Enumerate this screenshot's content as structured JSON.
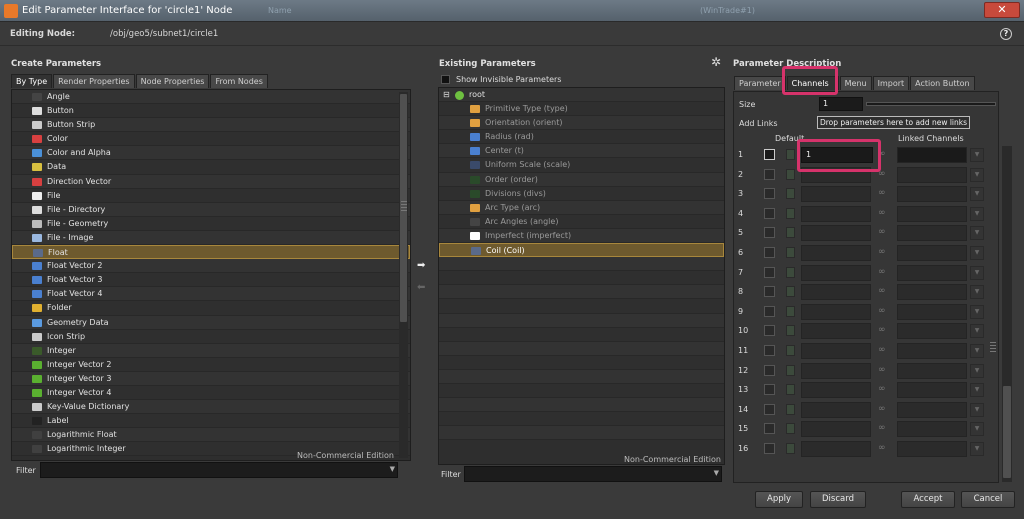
{
  "window": {
    "title": "Edit Parameter Interface for 'circle1' Node",
    "ghost_left": "Name",
    "ghost_right": "(WinTrade#1)",
    "close_label": "✕"
  },
  "editing": {
    "label": "Editing Node:",
    "path": "/obj/geo5/subnet1/circle1",
    "help_label": "?"
  },
  "create": {
    "title": "Create Parameters",
    "tabs": [
      "By Type",
      "Render Properties",
      "Node Properties",
      "From Nodes"
    ],
    "items": [
      {
        "label": "Angle",
        "icon": "angle-icon",
        "color": "#444444"
      },
      {
        "label": "Button",
        "icon": "button-icon",
        "color": "#dddddd"
      },
      {
        "label": "Button Strip",
        "icon": "button-strip-icon",
        "color": "#cccccc"
      },
      {
        "label": "Color",
        "icon": "color-icon",
        "color": "#d84040"
      },
      {
        "label": "Color and Alpha",
        "icon": "color-alpha-icon",
        "color": "#4a90d8"
      },
      {
        "label": "Data",
        "icon": "data-icon",
        "color": "#d8c040"
      },
      {
        "label": "Direction Vector",
        "icon": "direction-vector-icon",
        "color": "#d84040"
      },
      {
        "label": "File",
        "icon": "file-icon",
        "color": "#eeeeee"
      },
      {
        "label": "File - Directory",
        "icon": "file-directory-icon",
        "color": "#dddddd"
      },
      {
        "label": "File - Geometry",
        "icon": "file-geometry-icon",
        "color": "#bbbbbb"
      },
      {
        "label": "File - Image",
        "icon": "file-image-icon",
        "color": "#9ab8e0"
      },
      {
        "label": "Float",
        "icon": "float-icon",
        "color": "#5a6a8a"
      },
      {
        "label": "Float Vector 2",
        "icon": "float-vector2-icon",
        "color": "#4a80d0"
      },
      {
        "label": "Float Vector 3",
        "icon": "float-vector3-icon",
        "color": "#4a80d0"
      },
      {
        "label": "Float Vector 4",
        "icon": "float-vector4-icon",
        "color": "#4a80d0"
      },
      {
        "label": "Folder",
        "icon": "folder-icon",
        "color": "#e0b030"
      },
      {
        "label": "Geometry Data",
        "icon": "geometry-data-icon",
        "color": "#5a9ae0"
      },
      {
        "label": "Icon Strip",
        "icon": "icon-strip-icon",
        "color": "#cccccc"
      },
      {
        "label": "Integer",
        "icon": "integer-icon",
        "color": "#3a5a2a"
      },
      {
        "label": "Integer Vector 2",
        "icon": "integer-vector2-icon",
        "color": "#5ab030"
      },
      {
        "label": "Integer Vector 3",
        "icon": "integer-vector3-icon",
        "color": "#5ab030"
      },
      {
        "label": "Integer Vector 4",
        "icon": "integer-vector4-icon",
        "color": "#5ab030"
      },
      {
        "label": "Key-Value Dictionary",
        "icon": "key-value-icon",
        "color": "#cccccc"
      },
      {
        "label": "Label",
        "icon": "label-icon",
        "color": "#222222"
      },
      {
        "label": "Logarithmic Float",
        "icon": "log-float-icon",
        "color": "#404040"
      },
      {
        "label": "Logarithmic Integer",
        "icon": "log-integer-icon",
        "color": "#404040"
      }
    ],
    "selected_index": 11,
    "watermark": "Non-Commercial Edition",
    "filter_label": "Filter"
  },
  "existing": {
    "title": "Existing Parameters",
    "show_invisible": "Show Invisible Parameters",
    "root": "root",
    "items": [
      {
        "label": "Primitive Type (type)",
        "icon": "menu-icon",
        "color": "#e0a040"
      },
      {
        "label": "Orientation (orient)",
        "icon": "menu-icon",
        "color": "#e0a040"
      },
      {
        "label": "Radius (rad)",
        "icon": "float-vector2-icon",
        "color": "#4a80d0"
      },
      {
        "label": "Center (t)",
        "icon": "float-vector2-icon",
        "color": "#4a80d0"
      },
      {
        "label": "Uniform Scale (scale)",
        "icon": "float-icon",
        "color": "#3a4a6a"
      },
      {
        "label": "Order (order)",
        "icon": "integer-icon",
        "color": "#2a4a2a"
      },
      {
        "label": "Divisions (divs)",
        "icon": "integer-icon",
        "color": "#2a4a2a"
      },
      {
        "label": "Arc Type (arc)",
        "icon": "menu-icon",
        "color": "#e0a040"
      },
      {
        "label": "Arc Angles (angle)",
        "icon": "angle-icon",
        "color": "#444444"
      },
      {
        "label": "Imperfect (imperfect)",
        "icon": "checkbox-icon",
        "color": "#ffffff"
      },
      {
        "label": "Coil (Coil)",
        "icon": "float-icon",
        "color": "#5a6a8a"
      }
    ],
    "selected_index": 10,
    "watermark": "Non-Commercial Edition",
    "filter_label": "Filter"
  },
  "description": {
    "title": "Parameter Description",
    "tabs": [
      "Parameter",
      "Channels",
      "Menu",
      "Import",
      "Action Button"
    ],
    "active_tab": 1,
    "size_label": "Size",
    "size_value": "1",
    "add_links_label": "Add Links",
    "drop_hint": "Drop parameters here to add new links",
    "default_header": "Default",
    "linked_header": "Linked Channels",
    "first_value": "1",
    "rows": [
      "1",
      "2",
      "3",
      "4",
      "5",
      "6",
      "7",
      "8",
      "9",
      "10",
      "11",
      "12",
      "13",
      "14",
      "15",
      "16"
    ]
  },
  "buttons": {
    "apply": "Apply",
    "discard": "Discard",
    "accept": "Accept",
    "cancel": "Cancel"
  },
  "accent": {
    "highlight": "#d6336b",
    "selection": "#6e5a2e"
  }
}
